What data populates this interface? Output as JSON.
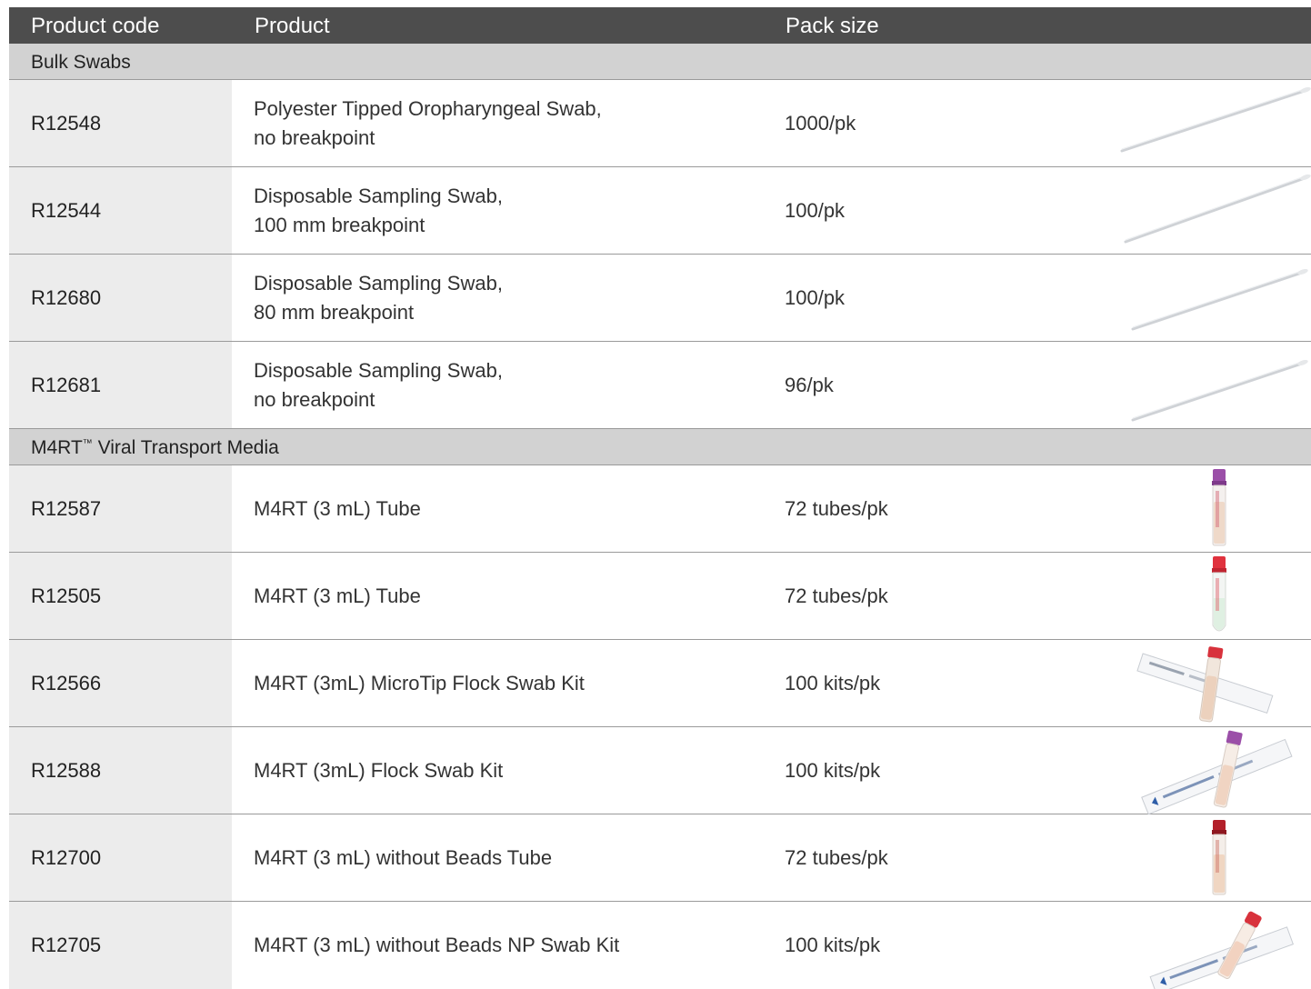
{
  "header": {
    "code": "Product code",
    "product": "Product",
    "pack": "Pack size"
  },
  "sections": [
    {
      "title": "Bulk Swabs",
      "rows": [
        {
          "code": "R12548",
          "product_line1": "Polyester Tipped Oropharyngeal Swab,",
          "product_line2": "no breakpoint",
          "pack": "1000/pk",
          "image": "swab-icon"
        },
        {
          "code": "R12544",
          "product_line1": "Disposable Sampling Swab,",
          "product_line2": "100 mm breakpoint",
          "pack": "100/pk",
          "image": "swab-icon"
        },
        {
          "code": "R12680",
          "product_line1": "Disposable Sampling Swab,",
          "product_line2": "80 mm breakpoint",
          "pack": "100/pk",
          "image": "swab-icon"
        },
        {
          "code": "R12681",
          "product_line1": "Disposable Sampling Swab,",
          "product_line2": "no breakpoint",
          "pack": "96/pk",
          "image": "swab-icon"
        }
      ]
    },
    {
      "title": "M4RT",
      "title_mark": "™",
      "title_rest": " Viral Transport Media",
      "rows": [
        {
          "code": "R12587",
          "product_line1": "M4RT (3 mL) Tube",
          "pack": "72 tubes/pk",
          "image": "tube-purple-icon"
        },
        {
          "code": "R12505",
          "product_line1": "M4RT (3 mL) Tube",
          "pack": "72 tubes/pk",
          "image": "tube-red-icon"
        },
        {
          "code": "R12566",
          "product_line1": "M4RT (3mL) MicroTip Flock Swab Kit",
          "pack": "100 kits/pk",
          "image": "swab-kit-icon"
        },
        {
          "code": "R12588",
          "product_line1": "M4RT (3mL) Flock Swab Kit",
          "pack": "100 kits/pk",
          "image": "swab-kit-icon"
        },
        {
          "code": "R12700",
          "product_line1": "M4RT (3 mL) without Beads Tube",
          "pack": "72 tubes/pk",
          "image": "tube-darkred-icon"
        },
        {
          "code": "R12705",
          "product_line1": "M4RT (3 mL) without Beads NP Swab Kit",
          "pack": "100 kits/pk",
          "image": "swab-kit-icon"
        }
      ]
    }
  ],
  "colors": {
    "header_bg": "#4d4d4d",
    "section_bg": "#d2d2d2",
    "code_cell_bg": "#ececec",
    "cap_purple": "#9b4fa8",
    "cap_red": "#e0323e",
    "cap_darkred": "#b3202a"
  }
}
